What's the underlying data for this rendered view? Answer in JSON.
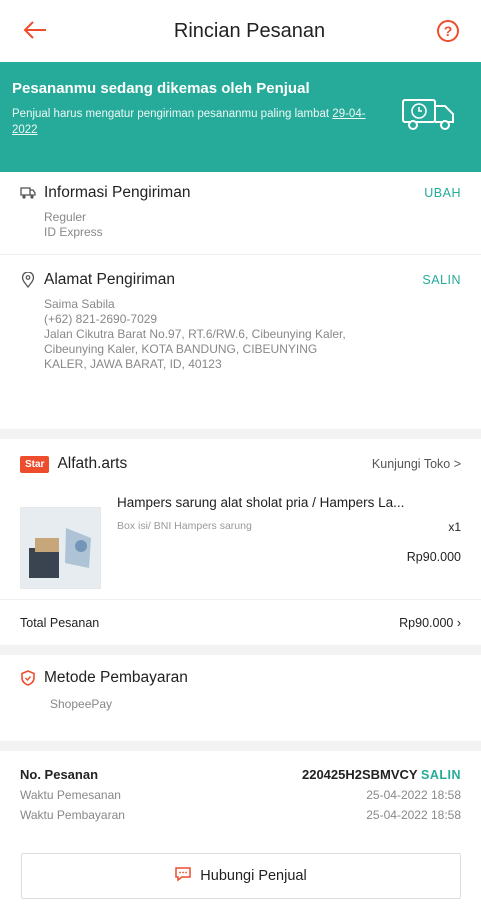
{
  "header": {
    "back_icon": "arrow-left-icon",
    "title": "Rincian Pesanan",
    "help_icon": "question-circle-icon"
  },
  "banner": {
    "title": "Pesananmu sedang dikemas oleh Penjual",
    "text": "Penjual harus mengatur pengiriman pesananmu paling lambat",
    "date": "29-04-2022",
    "icon": "truck-clock-icon",
    "color": "#26aa99"
  },
  "shipping": {
    "label": "Informasi Pengiriman",
    "action": "UBAH",
    "service": "Reguler",
    "courier": "ID Express",
    "icon": "truck-icon"
  },
  "address": {
    "label": "Alamat Pengiriman",
    "action": "SALIN",
    "icon": "location-pin-icon",
    "name": "Saima Sabila",
    "phone": "(+62) 821-2690-7029",
    "line1": "Jalan Cikutra Barat No.97, RT.6/RW.6, Cibeunying Kaler,",
    "line2": "Cibeunying Kaler, KOTA BANDUNG, CIBEUNYING",
    "line3": "KALER, JAWA BARAT, ID, 40123"
  },
  "shop": {
    "badge": "Star",
    "name": "Alfath.arts",
    "visit": "Kunjungi Toko >"
  },
  "product": {
    "name": "Hampers sarung alat sholat pria / Hampers La...",
    "variant": "Box isi/ BNI Hampers sarung",
    "qty": "x1",
    "price": "Rp90.000"
  },
  "total": {
    "label": "Total Pesanan",
    "value": "Rp90.000 ›"
  },
  "payment": {
    "label": "Metode Pembayaran",
    "method": "ShopeePay",
    "icon": "shield-icon"
  },
  "order": {
    "no_label": "No. Pesanan",
    "no_value": "220425H2SBMVCY",
    "no_action": "SALIN",
    "order_time_label": "Waktu Pemesanan",
    "order_time_value": "25-04-2022 18:58",
    "pay_time_label": "Waktu Pembayaran",
    "pay_time_value": "25-04-2022 18:58"
  },
  "contact": {
    "label": "Hubungi Penjual",
    "icon": "chat-bubble-icon"
  }
}
